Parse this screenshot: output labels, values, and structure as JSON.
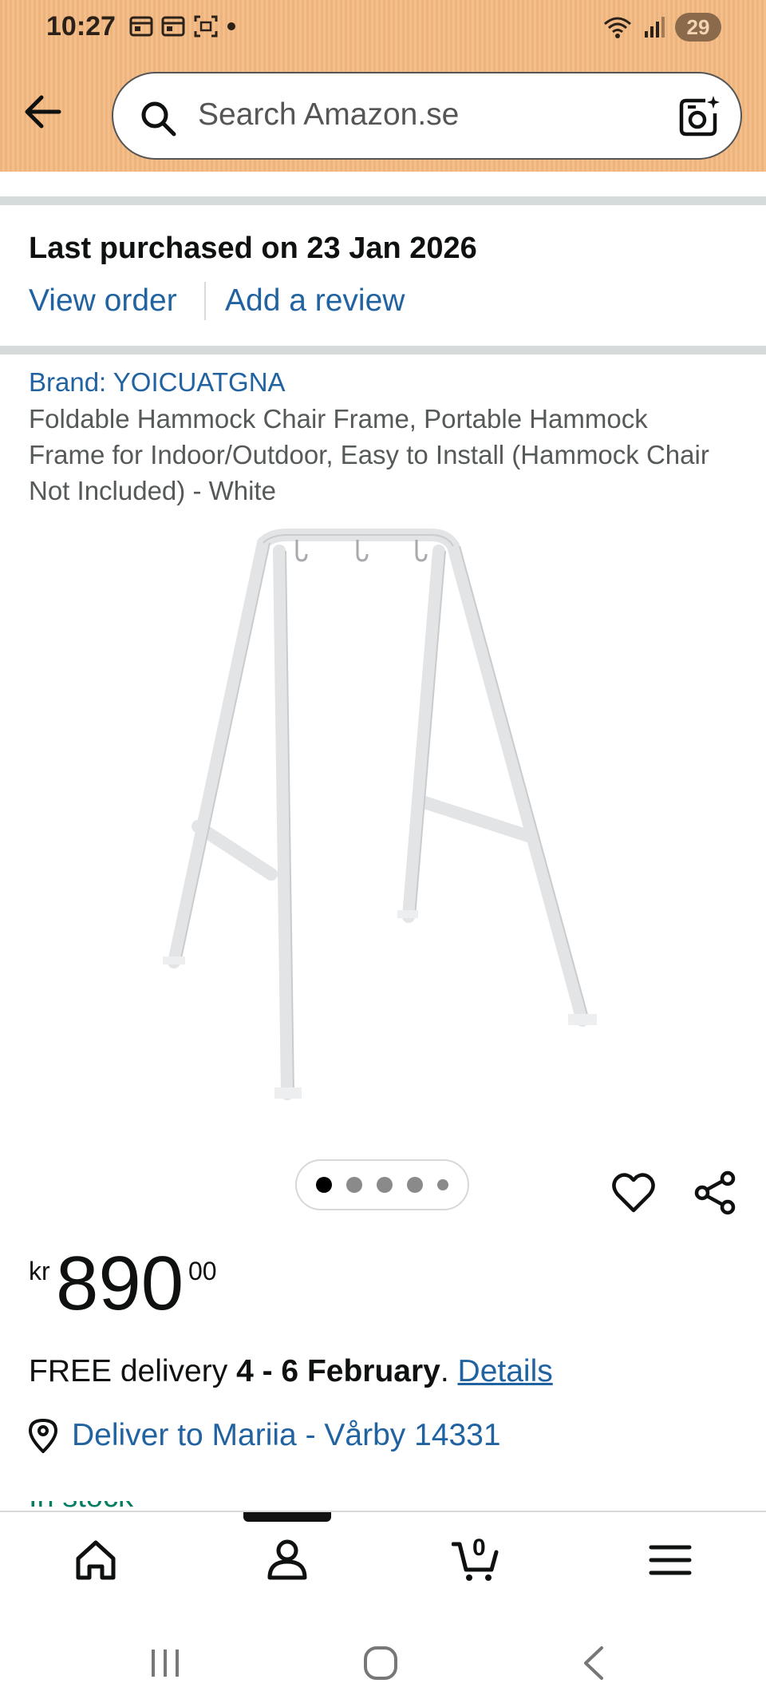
{
  "status_bar": {
    "time": "10:27",
    "battery": "29"
  },
  "search": {
    "placeholder": "Search Amazon.se"
  },
  "purchase": {
    "title": "Last purchased on 23 Jan 2026",
    "view_order": "View order",
    "add_review": "Add a review"
  },
  "product": {
    "brand": "Brand: YOICUATGNA",
    "title": "Foldable Hammock Chair Frame, Portable Hammock Frame for Indoor/Outdoor, Easy to Install (Hammock Chair Not Included) - White",
    "image_count": 5,
    "active_image": 1
  },
  "price": {
    "currency": "kr",
    "whole": "890",
    "fraction": "00"
  },
  "delivery": {
    "prefix": "FREE delivery ",
    "dates": "4 - 6 February",
    "suffix": ". ",
    "details": "Details"
  },
  "deliver_to": "Deliver to Mariia - Vårby 14331",
  "partial_line": "In stock",
  "bottom_nav": {
    "cart_count": "0"
  },
  "colors": {
    "header": "#efb47c",
    "link": "#2162a1",
    "divider": "#d5dbdb"
  }
}
